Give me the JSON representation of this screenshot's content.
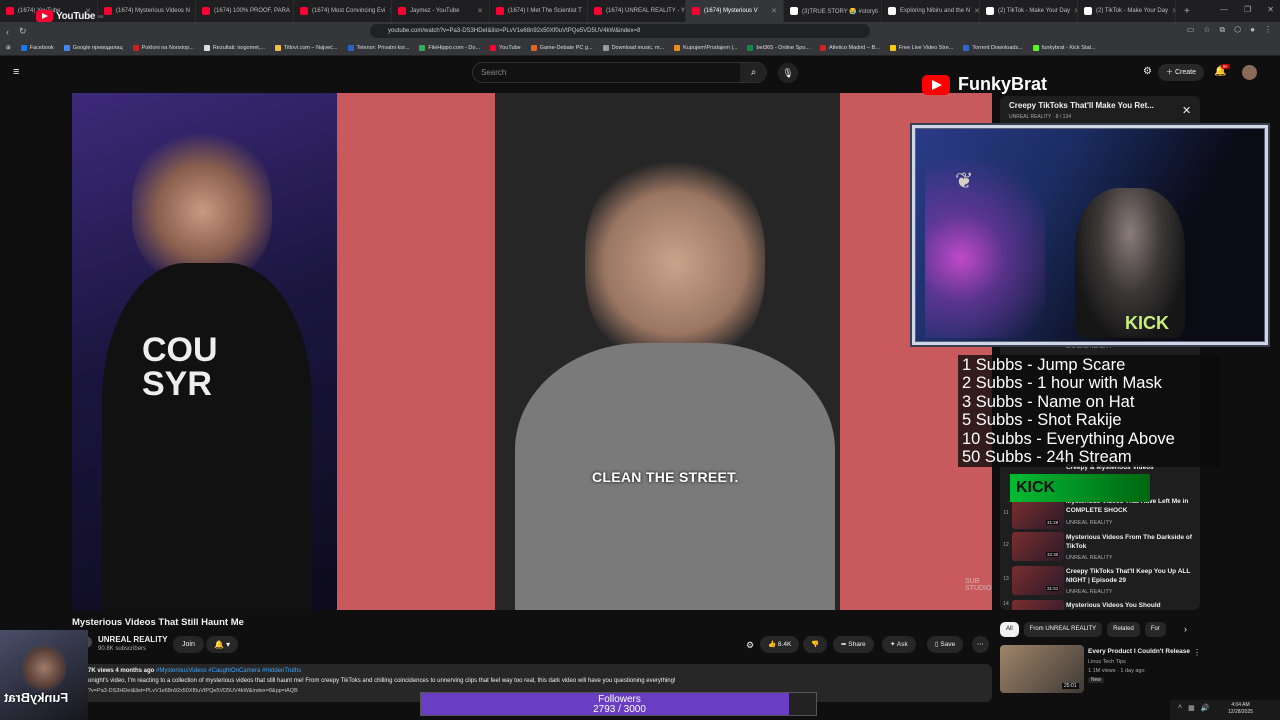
{
  "browser": {
    "tabs": [
      {
        "label": "(1674) YouTube",
        "color": "#ff0033"
      },
      {
        "label": "(1674) Mysterious Videos N",
        "color": "#ff0033"
      },
      {
        "label": "(1674) 100% PROOF, PARA",
        "color": "#ff0033"
      },
      {
        "label": "(1674) Most Convincing Evi",
        "color": "#ff0033"
      },
      {
        "label": "Jaymez - YouTube",
        "color": "#ff0033"
      },
      {
        "label": "(1674) I Met The Scientist T",
        "color": "#ff0033"
      },
      {
        "label": "(1674) UNREAL REALITY - Y",
        "color": "#ff0033"
      },
      {
        "label": "(1674) Mysterious V",
        "color": "#ff0033"
      },
      {
        "label": "(3)TRUE STORY 😭 #storyti",
        "color": "#ffffff"
      },
      {
        "label": "Exploring Nibiru and the N",
        "color": "#ffffff"
      },
      {
        "label": "(2) TikTok - Make Your Day",
        "color": "#ffffff"
      },
      {
        "label": "(2) TikTok - Make Your Day",
        "color": "#ffffff"
      }
    ],
    "active_tab_index": 7,
    "url": "youtube.com/watch?v=Pa3-DS3HDeI&list=PLvV1e68n92x50Xf0uVtPQe5VD5UV4kW&index=8",
    "bookmarks": [
      {
        "label": "Facebook",
        "color": "#1877f2"
      },
      {
        "label": "Google преводилац",
        "color": "#4285f4"
      },
      {
        "label": "Pokloni na Nonstop...",
        "color": "#cc2222"
      },
      {
        "label": "Rezultati: nogomet,...",
        "color": "#dddddd"
      },
      {
        "label": "Titlovi.com – Najveć...",
        "color": "#f0c040"
      },
      {
        "label": "Telenor: Privatni kor...",
        "color": "#2266cc"
      },
      {
        "label": "FileHippo.com - Do...",
        "color": "#33aa55"
      },
      {
        "label": "YouTube",
        "color": "#ff0033"
      },
      {
        "label": "Game-Debate PC g...",
        "color": "#dd6622"
      },
      {
        "label": "Download music, m...",
        "color": "#999999"
      },
      {
        "label": "Kupujem!Prodajem |...",
        "color": "#ee8822"
      },
      {
        "label": "bet365 - Online Spo...",
        "color": "#118844"
      },
      {
        "label": "Atletico Madrid – B...",
        "color": "#cc2222"
      },
      {
        "label": "Free Live Video Stre...",
        "color": "#ffcc00"
      },
      {
        "label": "Torrent Downloads...",
        "color": "#3366cc"
      },
      {
        "label": "funkybrat - Kick Stat...",
        "color": "#53fc18"
      }
    ]
  },
  "youtube": {
    "logo_text": "YouTube",
    "logo_region": "RS",
    "search_placeholder": "Search",
    "create_label": "Create",
    "notifications": "9+"
  },
  "video": {
    "caption": "CLEAN THE STREET.",
    "watermark": "SUB STUDIO",
    "title": "Mysterious Videos That Still Haunt Me",
    "channel": "UNREAL REALITY",
    "subscribers": "90.8K subscribers",
    "join_label": "Join",
    "likes": "8.4K",
    "share_label": "Share",
    "ask_label": "Ask",
    "save_label": "Save",
    "views_age": "7K views  4 months ago",
    "tags": "#MysteriousVideos #CaughtOnCamera #HiddenTruths",
    "description": "onight's video, I'm reacting to a collection of mysterious videos that still haunt me! From creepy TikToks and chilling coincidences to unnerving clips that feel way too real, this dark video will have you questioning everything!",
    "link": "?v=Pa3-DS3HDeI&list=PLvV1e68n92x50Xf0uVtPQe5VD5UV4kW&index=8&pp=iAQB"
  },
  "playlist": {
    "title": "Creepy TikToks That'll Make You Ret...",
    "subtitle": "UNREAL REALITY · 8 / 134",
    "items": [
      {
        "idx": "",
        "title": "Mysterious Videos That Have Left Me in COMPLETE SHOCK",
        "channel": "UNREAL REALITY",
        "duration": "31:29",
        "num": "11"
      },
      {
        "idx": "12",
        "title": "Mysterious Videos From The Darkside of TikTok",
        "channel": "UNREAL REALITY",
        "duration": "32:30"
      },
      {
        "idx": "13",
        "title": "Creepy TikToks That'll Keep You Up ALL NIGHT | Episode 29",
        "channel": "UNREAL REALITY",
        "duration": "31:51"
      },
      {
        "idx": "14",
        "title": "Mysterious Videos You Should",
        "channel": "",
        "duration": ""
      }
    ],
    "partial_rows": [
      "UNREAL REALITY",
      "Mysterious Videos You ...",
      "Mysterious Videos That Have",
      "Creepy & Mysterious Videos"
    ]
  },
  "chips": [
    "All",
    "From UNREAL REALITY",
    "Related",
    "For"
  ],
  "recommendation": {
    "title": "Every Product I Couldn't Release",
    "channel": "Linus Tech Tips",
    "views": "1.1M views · 1 day ago",
    "badge": "New",
    "duration": "25:01"
  },
  "overlay": {
    "streamer": "FunkyBrat",
    "goals": [
      "1 Subbs - Jump Scare",
      "2 Subbs - 1 hour with Mask",
      "3 Subbs - Name on Hat",
      "5 Subbs - Shot Rakije",
      "10 Subbs - Everything Above",
      "50 Subbs - 24h Stream"
    ],
    "followers_label": "Followers",
    "followers_count": "2793 / 3000",
    "followers_progress": 0.931,
    "cam_name": "FunkyBrat",
    "kick_text": "KICK"
  },
  "system": {
    "time": "4:04 AM",
    "date": "12/28/2025"
  }
}
